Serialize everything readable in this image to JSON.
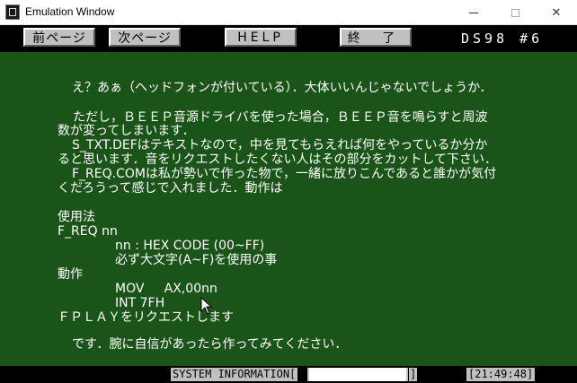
{
  "window": {
    "title": "Emulation Window",
    "controls": {
      "minimize": "minimize",
      "maximize": "maximize",
      "close": "✕"
    }
  },
  "menubar": {
    "prev_page": "前ページ",
    "next_page": "次ページ",
    "help": "HELP",
    "end": "終 了",
    "disk_label": "DS98 #6"
  },
  "screen": {
    "lines": [
      "え？あぁ（ヘッドフォンが付いている）．大体いいんじゃないでしょうか．",
      "ただし，ＢＥＥＰ音源ドライバを使った場合，ＢＥＥＰ音を鳴らすと周波",
      "数が変ってしまいます．",
      "S_TXT.DEFはテキストなので，中を見てもらえれば何をやっているか分か",
      "ると思います．音をリクエストしたくない人はその部分をカットして下さい．",
      "F_REQ.COMは私が勢いで作った物で，一緒に放りこんであると誰かが気付",
      "くだろうって感じで入れました．動作は",
      "使用法",
      "F_REQ nn",
      "nn : HEX CODE (00~FF)",
      "必ず大文字(A~F)を使用の事",
      "動作",
      "MOV     AX,00nn",
      "INT 7FH",
      "ＦＰＬＡＹをリクエストします",
      "です．腕に自信があったら作ってみてください．"
    ]
  },
  "statusbar": {
    "system_information": "SYSTEM INFORMATION[",
    "field_value": "",
    "field_close": "]",
    "clock": "[21:49:48]"
  },
  "colors": {
    "screen_background": "#1b5418",
    "menubar_background": "#000000",
    "button_face": "#c0c0c0",
    "text": "#ffffff"
  }
}
